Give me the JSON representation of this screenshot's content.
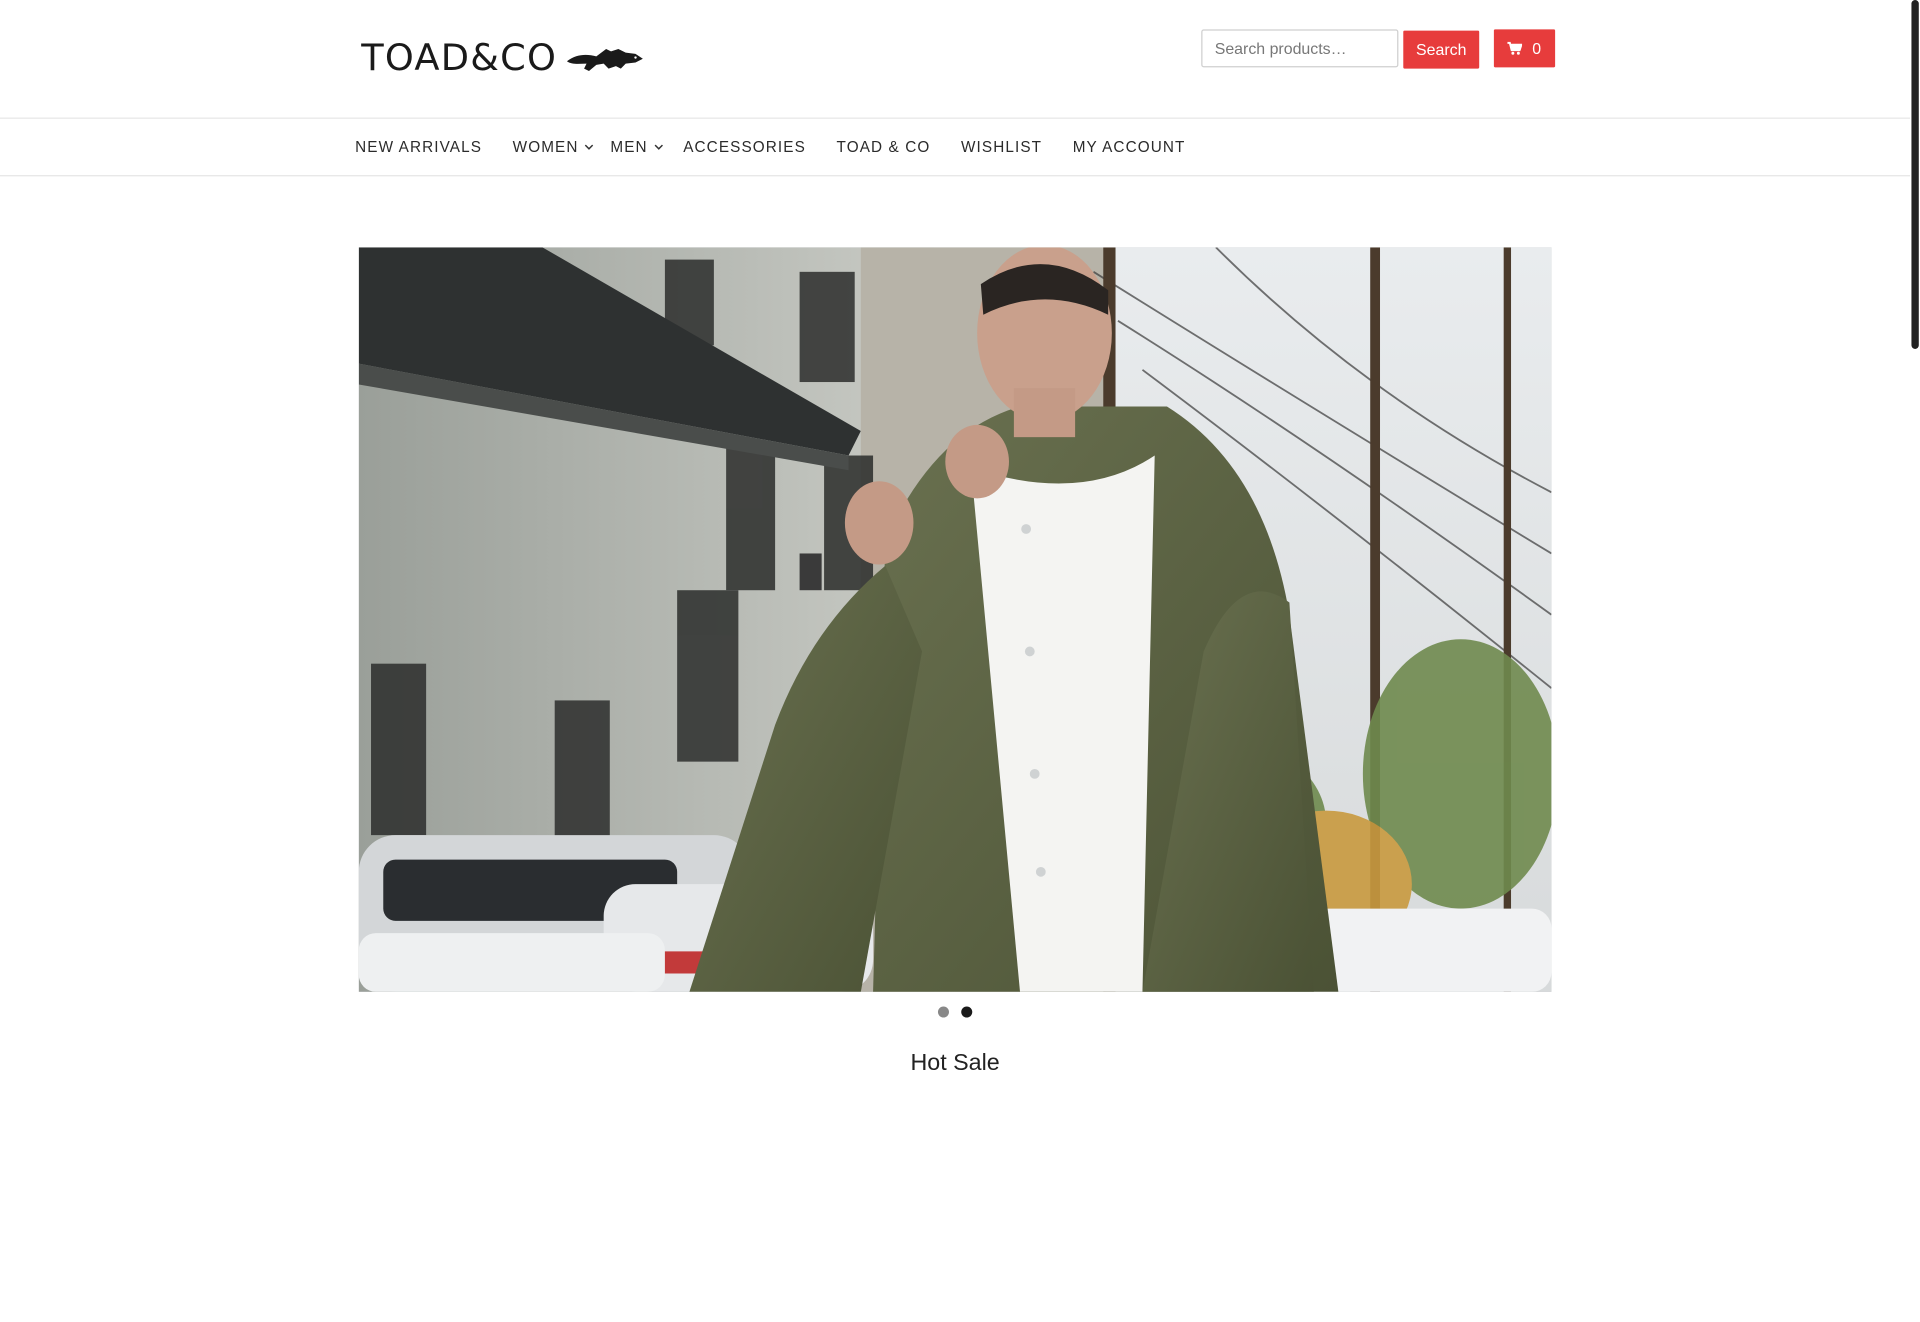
{
  "brand": {
    "name": "TOAD&CO",
    "logo_icon": "iguana-icon"
  },
  "search": {
    "placeholder": "Search products…",
    "button_label": "Search"
  },
  "cart": {
    "count": "0",
    "icon": "cart-icon"
  },
  "nav": {
    "items": [
      {
        "label": "NEW ARRIVALS",
        "has_submenu": false
      },
      {
        "label": "WOMEN",
        "has_submenu": true
      },
      {
        "label": "MEN",
        "has_submenu": true
      },
      {
        "label": "ACCESSORIES",
        "has_submenu": false
      },
      {
        "label": "TOAD & CO",
        "has_submenu": false
      },
      {
        "label": "WISHLIST",
        "has_submenu": false
      },
      {
        "label": "MY ACCOUNT",
        "has_submenu": false
      }
    ]
  },
  "slider": {
    "active_index": 1,
    "slide_count": 2
  },
  "section": {
    "title": "Hot Sale"
  },
  "colors": {
    "accent": "#e73c3c",
    "jacket": "#5b6240",
    "dot_inactive": "#888888",
    "dot_active": "#1a1a1a"
  }
}
